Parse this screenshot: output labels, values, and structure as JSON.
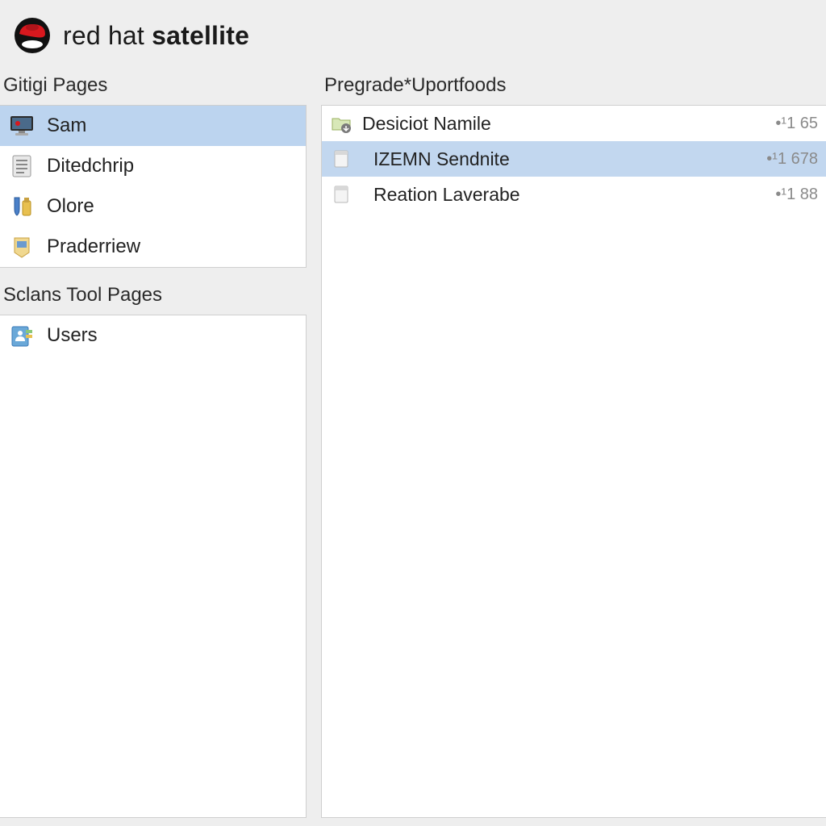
{
  "brand": {
    "prefix": "red hat ",
    "bold": "satellite",
    "icon": "redhat-fedora-icon"
  },
  "sidebar": {
    "sections": [
      {
        "title": "Gitigi Pages",
        "items": [
          {
            "label": "Sam",
            "icon": "monitor-icon",
            "selected": true
          },
          {
            "label": "Ditedchrip",
            "icon": "document-lines-icon",
            "selected": false
          },
          {
            "label": "Olore",
            "icon": "tools-icon",
            "selected": false
          },
          {
            "label": "Praderriew",
            "icon": "badge-icon",
            "selected": false
          }
        ]
      },
      {
        "title": "Sclans Tool Pages",
        "items": [
          {
            "label": "Users",
            "icon": "users-icon",
            "selected": false
          }
        ]
      }
    ]
  },
  "main": {
    "title": "Pregrade*Uportfoods",
    "rows": [
      {
        "label": "Desiciot Namile",
        "icon": "folder-arrow-icon",
        "selected": false,
        "indent": false,
        "meta": "•¹1 65"
      },
      {
        "label": "IZEMN Sendnite",
        "icon": "page-icon",
        "selected": true,
        "indent": true,
        "meta": "•¹1 678"
      },
      {
        "label": "Reation Laverabe",
        "icon": "page-icon",
        "selected": false,
        "indent": true,
        "meta": "•¹1 88"
      }
    ]
  }
}
